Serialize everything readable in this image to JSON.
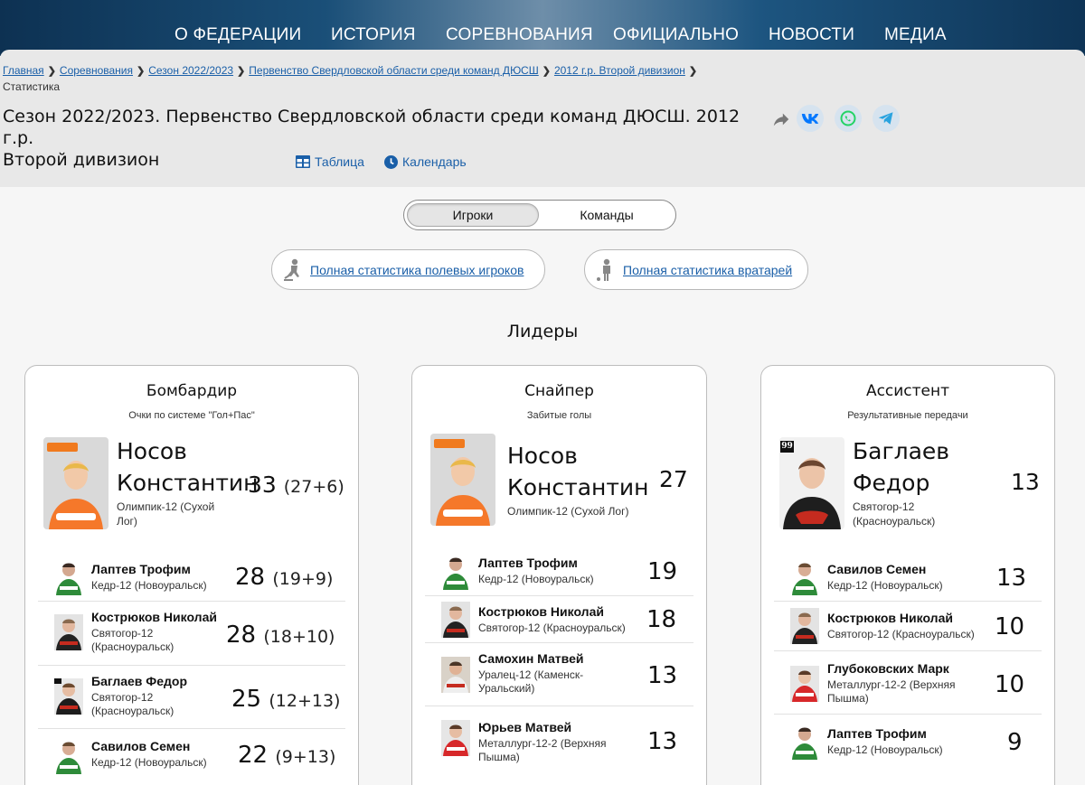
{
  "nav": [
    "О ФЕДЕРАЦИИ",
    "ИСТОРИЯ",
    "СОРЕВНОВАНИЯ",
    "ОФИЦИАЛЬНО",
    "НОВОСТИ",
    "МЕДИА"
  ],
  "breadcrumb": {
    "links": [
      "Главная",
      "Соревнования",
      "Сезон 2022/2023",
      "Первенство Свердловской области среди команд ДЮСШ",
      "2012 г.р. Второй дивизион"
    ],
    "current": "Статистика"
  },
  "title": {
    "line1": "Сезон 2022/2023. Первенство Свердловской области среди команд ДЮСШ. 2012 г.р.",
    "line2": "Второй дивизион"
  },
  "subtabs": {
    "table": "Таблица",
    "calendar": "Календарь"
  },
  "toggle": {
    "players": "Игроки",
    "teams": "Команды"
  },
  "stat_links": {
    "field": "Полная статистика полевых игроков",
    "goalies": "Полная статистика вратарей"
  },
  "leaders_title": "Лидеры",
  "colors": {
    "link": "#1a5fa8",
    "vk": "#0077ff",
    "whatsapp": "#25d366",
    "telegram": "#2aa3df"
  },
  "cards": [
    {
      "title": "Бомбардир",
      "subtitle": "Очки по системе \"Гол+Пас\"",
      "leader": {
        "name_first": "Носов",
        "name_last": "Константин",
        "team": "Олимпик-12 (Сухой Лог)",
        "value": "33",
        "detail": "(27+6)"
      },
      "rows": [
        {
          "name": "Лаптев Трофим",
          "team": "Кедр-12 (Новоуральск)",
          "value": "28",
          "detail": "(19+9)"
        },
        {
          "name": "Кострюков Николай",
          "team": "Святогор-12 (Красноуральск)",
          "value": "28",
          "detail": "(18+10)"
        },
        {
          "name": "Баглаев Федор",
          "team": "Святогор-12 (Красноуральск)",
          "value": "25",
          "detail": "(12+13)"
        },
        {
          "name": "Савилов Семен",
          "team": "Кедр-12 (Новоуральск)",
          "value": "22",
          "detail": "(9+13)"
        }
      ]
    },
    {
      "title": "Снайпер",
      "subtitle": "Забитые голы",
      "leader": {
        "name_first": "Носов",
        "name_last": "Константин",
        "team": "Олимпик-12 (Сухой Лог)",
        "value": "27",
        "detail": ""
      },
      "rows": [
        {
          "name": "Лаптев Трофим",
          "team": "Кедр-12 (Новоуральск)",
          "value": "19",
          "detail": ""
        },
        {
          "name": "Кострюков Николай",
          "team": "Святогор-12 (Красноуральск)",
          "value": "18",
          "detail": ""
        },
        {
          "name": "Самохин Матвей",
          "team": "Уралец-12 (Каменск-Уральский)",
          "value": "13",
          "detail": ""
        },
        {
          "name": "Юрьев Матвей",
          "team": "Металлург-12-2 (Верхняя Пышма)",
          "value": "13",
          "detail": ""
        }
      ]
    },
    {
      "title": "Ассистент",
      "subtitle": "Результативные передачи",
      "leader": {
        "name_first": "Баглаев",
        "name_last": "Федор",
        "team": "Святогор-12 (Красноуральск)",
        "value": "13",
        "detail": "",
        "badge": "99"
      },
      "rows": [
        {
          "name": "Савилов Семен",
          "team": "Кедр-12 (Новоуральск)",
          "value": "13",
          "detail": ""
        },
        {
          "name": "Кострюков Николай",
          "team": "Святогор-12 (Красноуральск)",
          "value": "10",
          "detail": ""
        },
        {
          "name": "Глубоковских Марк",
          "team": "Металлург-12-2 (Верхняя Пышма)",
          "value": "10",
          "detail": ""
        },
        {
          "name": "Лаптев Трофим",
          "team": "Кедр-12 (Новоуральск)",
          "value": "9",
          "detail": ""
        }
      ]
    }
  ]
}
